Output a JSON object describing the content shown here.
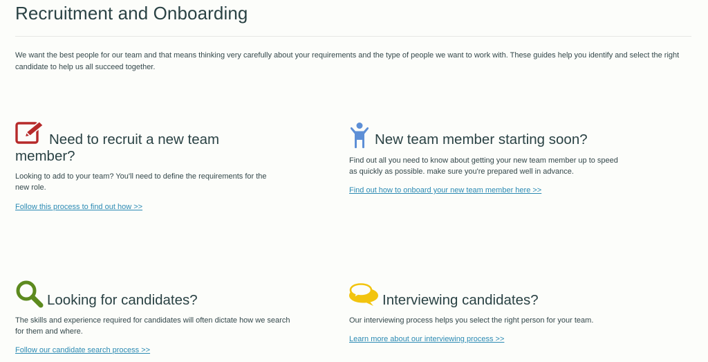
{
  "page": {
    "title": "Recruitment and Onboarding",
    "intro": "We want the best people for our team and that means thinking very carefully about your requirements and the type of people we want to work with. These guides help you identify and select the right candidate to help us all succeed together."
  },
  "cards": [
    {
      "heading": "Need to recruit a new team member?",
      "description": "Looking to add to your team? You'll need to define the requirements for the new role.",
      "link": "Follow this process to find out how >>",
      "icon": "edit-icon",
      "icon_color": "#b62a2a"
    },
    {
      "heading": "New team member starting soon?",
      "description": "Find out all you need to know about getting your new team member up to speed as quickly as possible. make sure you're prepared well in advance.",
      "link": "Find out how to onboard your new team member here >>",
      "icon": "person-icon",
      "icon_color": "#5d8fd6"
    },
    {
      "heading": "Looking for candidates?",
      "description": "The skills and experience required for candidates will often dictate how we search for them and where.",
      "link": "Follow our candidate search process >>",
      "icon": "search-icon",
      "icon_color": "#5c8a1e"
    },
    {
      "heading": "Interviewing candidates?",
      "description": "Our interviewing process helps you select the right person for your team.",
      "link": "Learn more about our interviewing process >>",
      "icon": "chat-bubbles-icon",
      "icon_color": "#f2c40f"
    }
  ],
  "colors": {
    "heading": "#2a4244",
    "body_text": "#33474a",
    "link": "#2b8ab3",
    "background": "#fcfdfa"
  }
}
